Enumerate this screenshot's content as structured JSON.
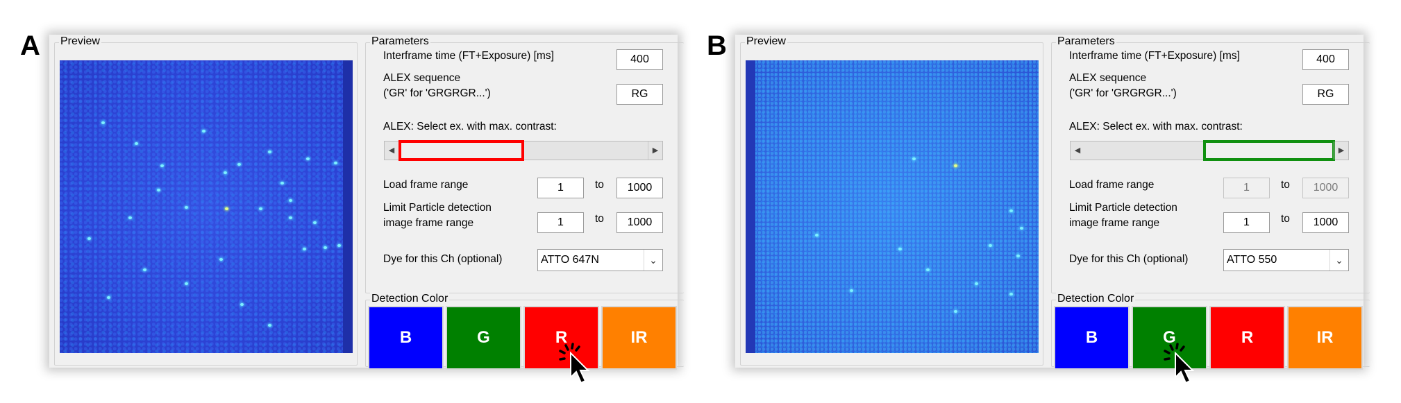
{
  "panels": [
    {
      "label": "A",
      "preview_title": "Preview",
      "parameters_title": "Parameters",
      "interframe_label": "Interframe time (FT+Exposure) [ms]",
      "interframe_value": "400",
      "alex_label_1": "ALEX sequence",
      "alex_label_2": "('GR' for 'GRGRGR...')",
      "alex_value": "RG",
      "contrast_label": "ALEX: Select ex. with max. contrast:",
      "contrast_highlight_color": "#ff0000",
      "load_range_label": "Load frame range",
      "load_from": "1",
      "load_to_word": "to",
      "load_to": "1000",
      "limit_label_1": "Limit Particle detection",
      "limit_label_2": "image frame range",
      "limit_from": "1",
      "limit_to_word": "to",
      "limit_to": "1000",
      "dye_label": "Dye for this Ch (optional)",
      "dye_value": "ATTO 647N",
      "detection_title": "Detection Color",
      "color_buttons": [
        {
          "label": "B",
          "color": "#0000ff"
        },
        {
          "label": "G",
          "color": "#008000"
        },
        {
          "label": "R",
          "color": "#ff0000"
        },
        {
          "label": "IR",
          "color": "#ff8000"
        }
      ],
      "selected_color": "R"
    },
    {
      "label": "B",
      "preview_title": "Preview",
      "parameters_title": "Parameters",
      "interframe_label": "Interframe time (FT+Exposure) [ms]",
      "interframe_value": "400",
      "alex_label_1": "ALEX sequence",
      "alex_label_2": "('GR' for 'GRGRGR...')",
      "alex_value": "RG",
      "contrast_label": "ALEX: Select ex. with max. contrast:",
      "contrast_highlight_color": "#109010",
      "load_range_label": "Load frame range",
      "load_from": "1",
      "load_to_word": "to",
      "load_to": "1000",
      "limit_label_1": "Limit Particle detection",
      "limit_label_2": "image frame range",
      "limit_from": "1",
      "limit_to_word": "to",
      "limit_to": "1000",
      "dye_label": "Dye for this Ch (optional)",
      "dye_value": "ATTO 550",
      "detection_title": "Detection Color",
      "color_buttons": [
        {
          "label": "B",
          "color": "#0000ff"
        },
        {
          "label": "G",
          "color": "#008000"
        },
        {
          "label": "R",
          "color": "#ff0000"
        },
        {
          "label": "IR",
          "color": "#ff8000"
        }
      ],
      "selected_color": "G"
    }
  ]
}
